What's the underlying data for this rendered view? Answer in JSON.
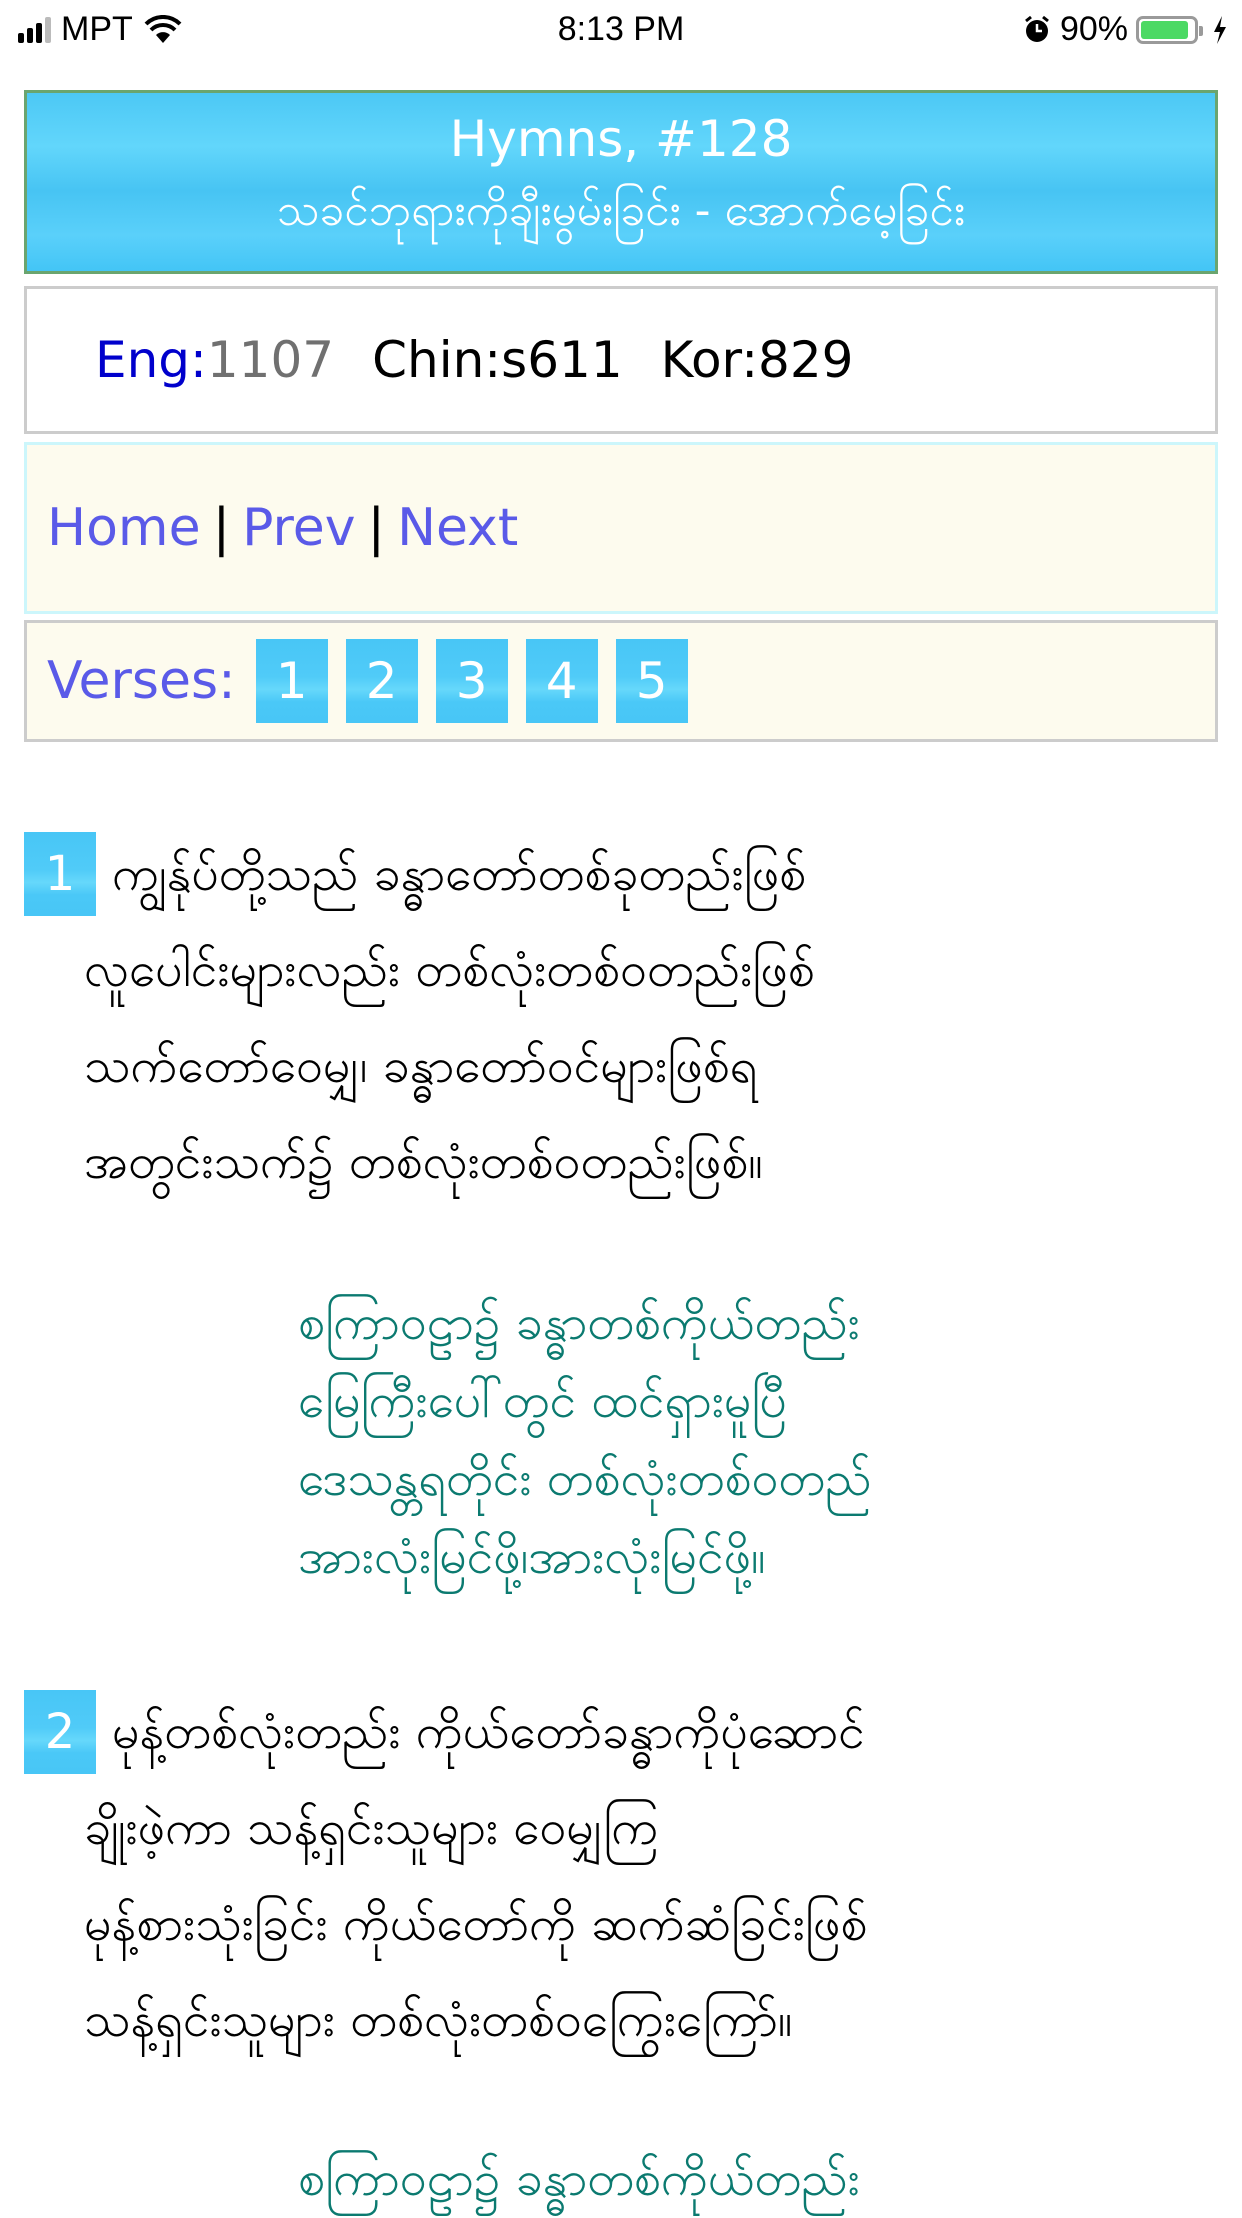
{
  "status_bar": {
    "carrier": "MPT",
    "time": "8:13 PM",
    "battery_percent": "90%",
    "battery_level": 0.9,
    "charging": true
  },
  "header": {
    "title": "Hymns, #128",
    "subtitle": "သခင်ဘုရားကိုချီးမွမ်းခြင်း - အောက်မေ့ခြင်း"
  },
  "numbers": {
    "eng_label": "Eng:",
    "eng_value": "1107",
    "chin": "Chin:s611",
    "kor": "Kor:829"
  },
  "nav": {
    "home": "Home",
    "prev": "Prev",
    "next": "Next",
    "separator": "|"
  },
  "verses_bar": {
    "label": "Verses:",
    "buttons": [
      "1",
      "2",
      "3",
      "4",
      "5"
    ]
  },
  "verses": [
    {
      "number": "1",
      "lines": [
        "ကျွန်ုပ်တို့သည် ခန္ဓာတော်တစ်ခုတည်းဖြစ်",
        "လူပေါင်းများလည်း တစ်လုံးတစ်ဝတည်းဖြစ်",
        "သက်တော်ဝေမျှ၊ ခန္ဓာတော်ဝင်များဖြစ်ရ",
        "အတွင်းသက်၌ တစ်လုံးတစ်ဝတည်းဖြစ်။"
      ],
      "chorus": [
        "စကြာဝဠာ၌ ခန္ဓာတစ်ကိုယ်တည်း",
        "မြေကြီးပေါ်တွင် ထင်ရှားမူပြီ",
        "ဒေသန္တရတိုင်း တစ်လုံးတစ်ဝတည်",
        "အားလုံးမြင်ဖို့၊အားလုံးမြင်ဖို့။"
      ]
    },
    {
      "number": "2",
      "lines": [
        "မုန့်တစ်လုံးတည်း ကိုယ်တော်ခန္ဓာကိုပုံဆောင်",
        "ချိုးဖဲ့ကာ သန့်ရှင်းသူများ ဝေမျှကြ",
        "မုန့်စားသုံးခြင်း ကိုယ်တော်ကို ဆက်ဆံခြင်းဖြစ်",
        "သန့်ရှင်းသူများ တစ်လုံးတစ်ဝကြွေးကြော်။"
      ],
      "chorus": [
        "စကြာဝဠာ၌ ခန္ဓာတစ်ကိုယ်တည်း"
      ]
    }
  ]
}
